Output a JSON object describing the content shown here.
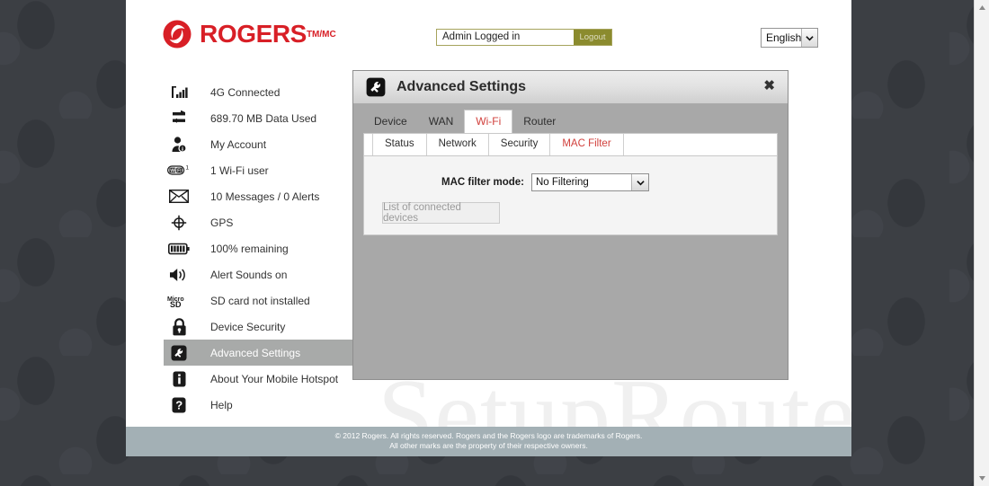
{
  "brand": {
    "name": "ROGERS",
    "trademark": "TM/MC",
    "accent_color": "#d81f26",
    "logo_icon": "rogers-swirl-icon"
  },
  "header": {
    "login_status": "Admin Logged in",
    "logout_label": "Logout",
    "language": "English",
    "language_options": [
      "English"
    ]
  },
  "sidebar": {
    "items": [
      {
        "icon": "signal-bars-icon",
        "label": "4G Connected",
        "active": false
      },
      {
        "icon": "data-transfer-icon",
        "label": "689.70 MB Data Used",
        "active": false
      },
      {
        "icon": "user-account-icon",
        "label": "My Account",
        "active": false
      },
      {
        "icon": "wifi-badge-icon",
        "label": "1 Wi-Fi user",
        "active": false
      },
      {
        "icon": "envelope-icon",
        "label": "10 Messages / 0 Alerts",
        "active": false
      },
      {
        "icon": "gps-crosshair-icon",
        "label": "GPS",
        "active": false
      },
      {
        "icon": "battery-icon",
        "label": "100% remaining",
        "active": false
      },
      {
        "icon": "speaker-icon",
        "label": "Alert Sounds on",
        "active": false
      },
      {
        "icon": "microsd-icon",
        "label": "SD card not installed",
        "active": false
      },
      {
        "icon": "padlock-icon",
        "label": "Device Security",
        "active": false
      },
      {
        "icon": "wrench-icon",
        "label": "Advanced Settings",
        "active": true
      },
      {
        "icon": "info-icon",
        "label": "About Your Mobile Hotspot",
        "active": false
      },
      {
        "icon": "question-icon",
        "label": "Help",
        "active": false
      }
    ]
  },
  "panel": {
    "icon": "wrench-icon",
    "title": "Advanced Settings",
    "close_label": "✖",
    "outer_tabs": [
      {
        "label": "Device",
        "active": false
      },
      {
        "label": "WAN",
        "active": false
      },
      {
        "label": "Wi-Fi",
        "active": true
      },
      {
        "label": "Router",
        "active": false
      }
    ],
    "inner_tabs": [
      {
        "label": "Status",
        "active": false
      },
      {
        "label": "Network",
        "active": false
      },
      {
        "label": "Security",
        "active": false
      },
      {
        "label": "MAC Filter",
        "active": true
      }
    ],
    "form": {
      "mac_filter_label": "MAC filter mode:",
      "mac_filter_value": "No Filtering",
      "mac_filter_options": [
        "No Filtering"
      ],
      "devices_button_label": "List of connected devices"
    },
    "active_tab_color": "#d1403c"
  },
  "watermark": {
    "text": "SetupRouter.co"
  },
  "footer": {
    "line1": "© 2012 Rogers. All rights reserved. Rogers and the Rogers logo are trademarks of Rogers.",
    "line2": "All other marks are the property of their respective owners."
  },
  "scrollbar": {
    "up_icon": "triangle-up-icon",
    "down_icon": "triangle-down-icon"
  }
}
